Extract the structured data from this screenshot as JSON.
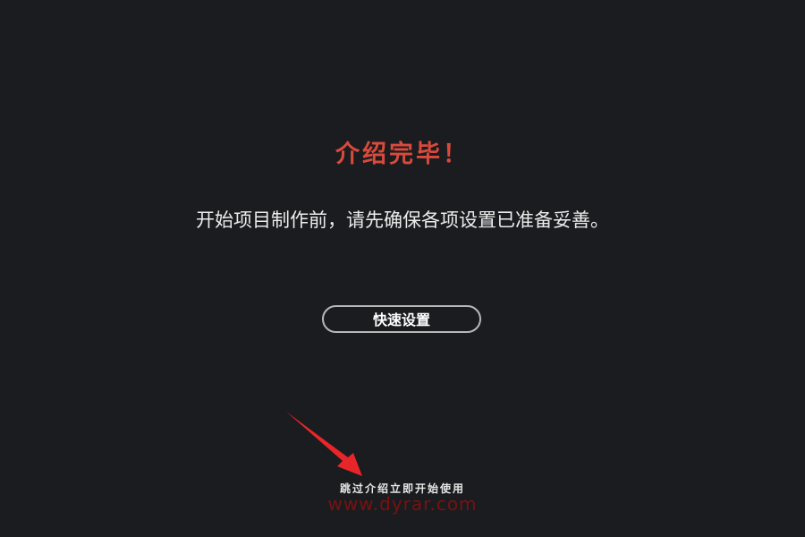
{
  "title": "介绍完毕！",
  "message": "开始项目制作前，请先确保各项设置已准备妥善。",
  "quick_setup_label": "快速设置",
  "skip_link_label": "跳过介绍立即开始使用",
  "watermark": "www.dyrar.com",
  "colors": {
    "background": "#1a1c1f",
    "title": "#d94a3c",
    "arrow": "#e8262a",
    "watermark": "#8a1010"
  },
  "icons": {
    "annotation_arrow": "arrow-annotation-icon"
  }
}
